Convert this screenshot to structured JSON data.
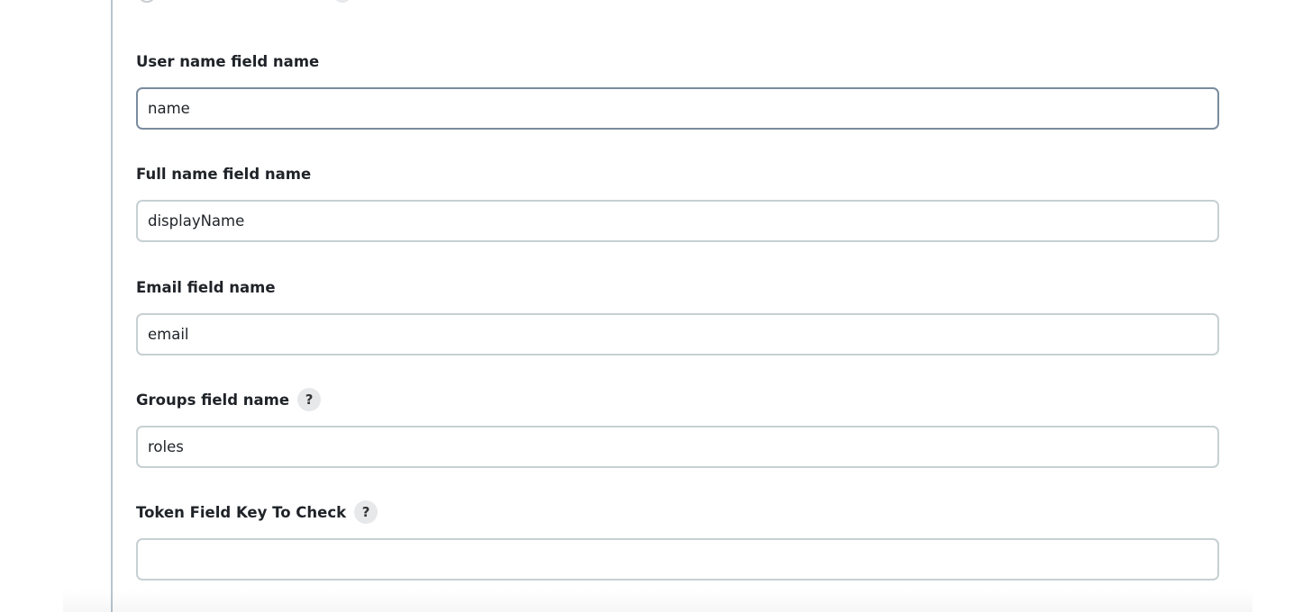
{
  "fields": [
    {
      "label": "User name field name",
      "value": "name",
      "placeholder": "",
      "help_icon": null
    },
    {
      "label": "Full name field name",
      "value": "displayName",
      "placeholder": "",
      "help_icon": null
    },
    {
      "label": "Email field name",
      "value": "email",
      "placeholder": "",
      "help_icon": null
    },
    {
      "label": "Groups field name",
      "value": "roles",
      "placeholder": "",
      "help_icon": "?"
    },
    {
      "label": "Token Field Key To Check",
      "value": "",
      "placeholder": "",
      "help_icon": "?"
    }
  ],
  "colors": {
    "input_border": "#c7d0d3",
    "input_border_focused": "#7a8c9e",
    "help_bg": "#e6e8ea",
    "rail": "#b8c4cc"
  }
}
